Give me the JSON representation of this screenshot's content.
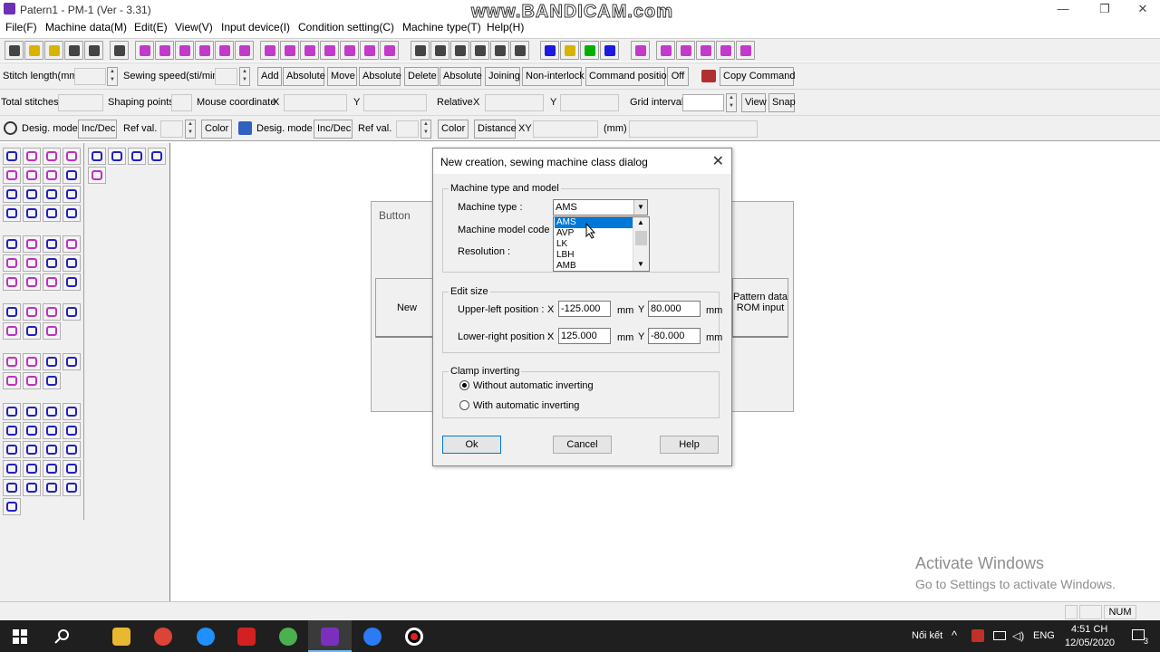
{
  "window": {
    "title": "Patern1 - PM-1 (Ver - 3.31)",
    "watermark": "www.BANDICAM.com",
    "minimize": "—",
    "maximize": "❐",
    "close": "✕"
  },
  "menu": [
    "File(F)",
    "Machine data(M)",
    "Edit(E)",
    "View(V)",
    "Input device(I)",
    "Condition setting(C)",
    "Machine type(T)",
    "Help(H)"
  ],
  "row1": {
    "stitch_length": "Stitch length(mm)",
    "sewing_speed": "Sewing speed(sti/min)",
    "add": "Add",
    "absolute1": "Absolute",
    "move": "Move",
    "absolute2": "Absolute",
    "delete": "Delete",
    "absolute3": "Absolute",
    "joining": "Joining",
    "non_interlock": "Non-interlock",
    "command_position": "Command position",
    "off": "Off",
    "copy_command": "Copy Command"
  },
  "row2": {
    "total_stitches": "Total stitches",
    "shaping_points": "Shaping points",
    "mouse_coordinate": "Mouse coordinate",
    "x": "X",
    "y": "Y",
    "relative": "Relative",
    "x2": "X",
    "y2": "Y",
    "grid_interval": "Grid interval",
    "view": "View",
    "snap": "Snap"
  },
  "row3": {
    "desig_mode1": "Desig. mode",
    "inc_dec1": "Inc/Dec",
    "ref_val1": "Ref val.",
    "color1": "Color",
    "desig_mode2": "Desig. mode",
    "inc_dec2": "Inc/Dec",
    "ref_val2": "Ref val.",
    "color2": "Color",
    "distance": "Distance",
    "xy": "XY",
    "mm": "(mm)"
  },
  "button_panel": {
    "title": "Button",
    "new": "New",
    "pattern_rom": "Pattern data ROM input"
  },
  "dialog": {
    "title": "New creation, sewing machine class dialog",
    "close": "✕",
    "group_machine": "Machine type and model",
    "machine_type_label": "Machine type :",
    "machine_type_value": "AMS",
    "machine_model_label": "Machine model code :",
    "resolution_label": "Resolution :",
    "dropdown_options": [
      "AMS",
      "AVP",
      "LK",
      "LBH",
      "AMB"
    ],
    "group_edit": "Edit size",
    "upper_left_label": "Upper-left position :",
    "lower_right_label": "Lower-right position :",
    "x_label": "X",
    "y_label": "Y",
    "mm_label": "mm",
    "ul_x": "-125.000",
    "ul_y": "80.000",
    "lr_x": "125.000",
    "lr_y": "-80.000",
    "group_clamp": "Clamp inverting",
    "without_auto": "Without automatic inverting",
    "with_auto": "With automatic inverting",
    "ok": "Ok",
    "cancel": "Cancel",
    "help": "Help"
  },
  "activate": {
    "line1": "Activate Windows",
    "line2": "Go to Settings to activate Windows."
  },
  "status": {
    "num": "NUM"
  },
  "taskbar": {
    "lang_label": "Nối kết",
    "eng": "ENG",
    "time": "4:51 CH",
    "date": "12/05/2020",
    "notif_count": "3"
  }
}
